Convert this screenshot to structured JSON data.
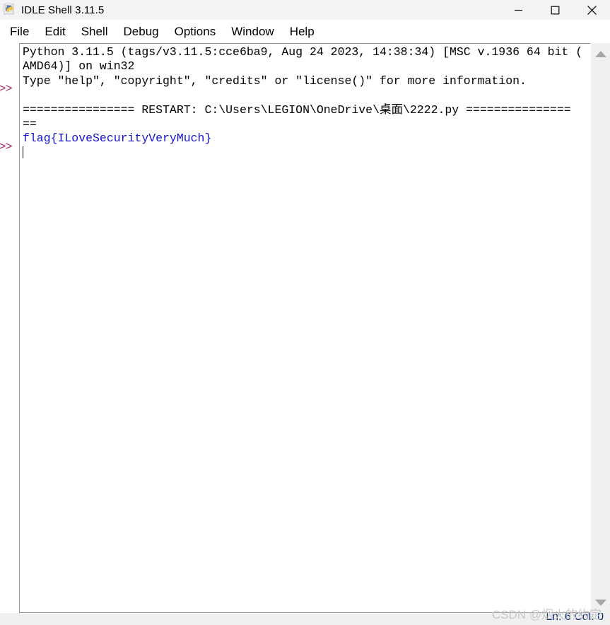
{
  "window": {
    "title": "IDLE Shell 3.11.5",
    "icon": "python-logo-icon",
    "controls": {
      "minimize": "minimize-icon",
      "maximize": "maximize-icon",
      "close": "close-icon"
    }
  },
  "menubar": {
    "items": [
      {
        "label": "File"
      },
      {
        "label": "Edit"
      },
      {
        "label": "Shell"
      },
      {
        "label": "Debug"
      },
      {
        "label": "Options"
      },
      {
        "label": "Window"
      },
      {
        "label": "Help"
      }
    ]
  },
  "shell": {
    "prompts": [
      {
        "text": ">>>"
      },
      {
        "text": ">>>"
      }
    ],
    "lines": [
      {
        "id": "banner-line-1",
        "color": "#000000",
        "text": "Python 3.11.5 (tags/v3.11.5:cce6ba9, Aug 24 2023, 14:38:34) [MSC v.1936 64 bit ("
      },
      {
        "id": "banner-line-2",
        "color": "#000000",
        "text": "AMD64)] on win32"
      },
      {
        "id": "banner-line-3",
        "color": "#000000",
        "text": "Type \"help\", \"copyright\", \"credits\" or \"license()\" for more information."
      },
      {
        "id": "blank-line-1",
        "color": "#000000",
        "text": ""
      },
      {
        "id": "restart-line-1",
        "color": "#000000",
        "text": "================ RESTART: C:\\Users\\LEGION\\OneDrive\\桌面\\2222.py ==============="
      },
      {
        "id": "restart-line-2",
        "color": "#000000",
        "text": "=="
      },
      {
        "id": "output-flag",
        "color": "#1414cf",
        "text": "flag{ILoveSecurityVeryMuch}"
      }
    ],
    "caret": ""
  },
  "scrollbar": {
    "up_arrow": "scroll-up-arrow-icon",
    "down_arrow": "scroll-down-arrow-icon"
  },
  "statusbar": {
    "position": "Ln: 6  Col: 0"
  },
  "watermark": {
    "text": "CSDN @烟火的约定"
  },
  "colors": {
    "titlebar_bg": "#f3f3f6",
    "prompt": "#b0306e",
    "output_blue": "#1414cf",
    "status_text": "#0b2a6b",
    "scrollbar_bg": "#f0f0f0"
  }
}
